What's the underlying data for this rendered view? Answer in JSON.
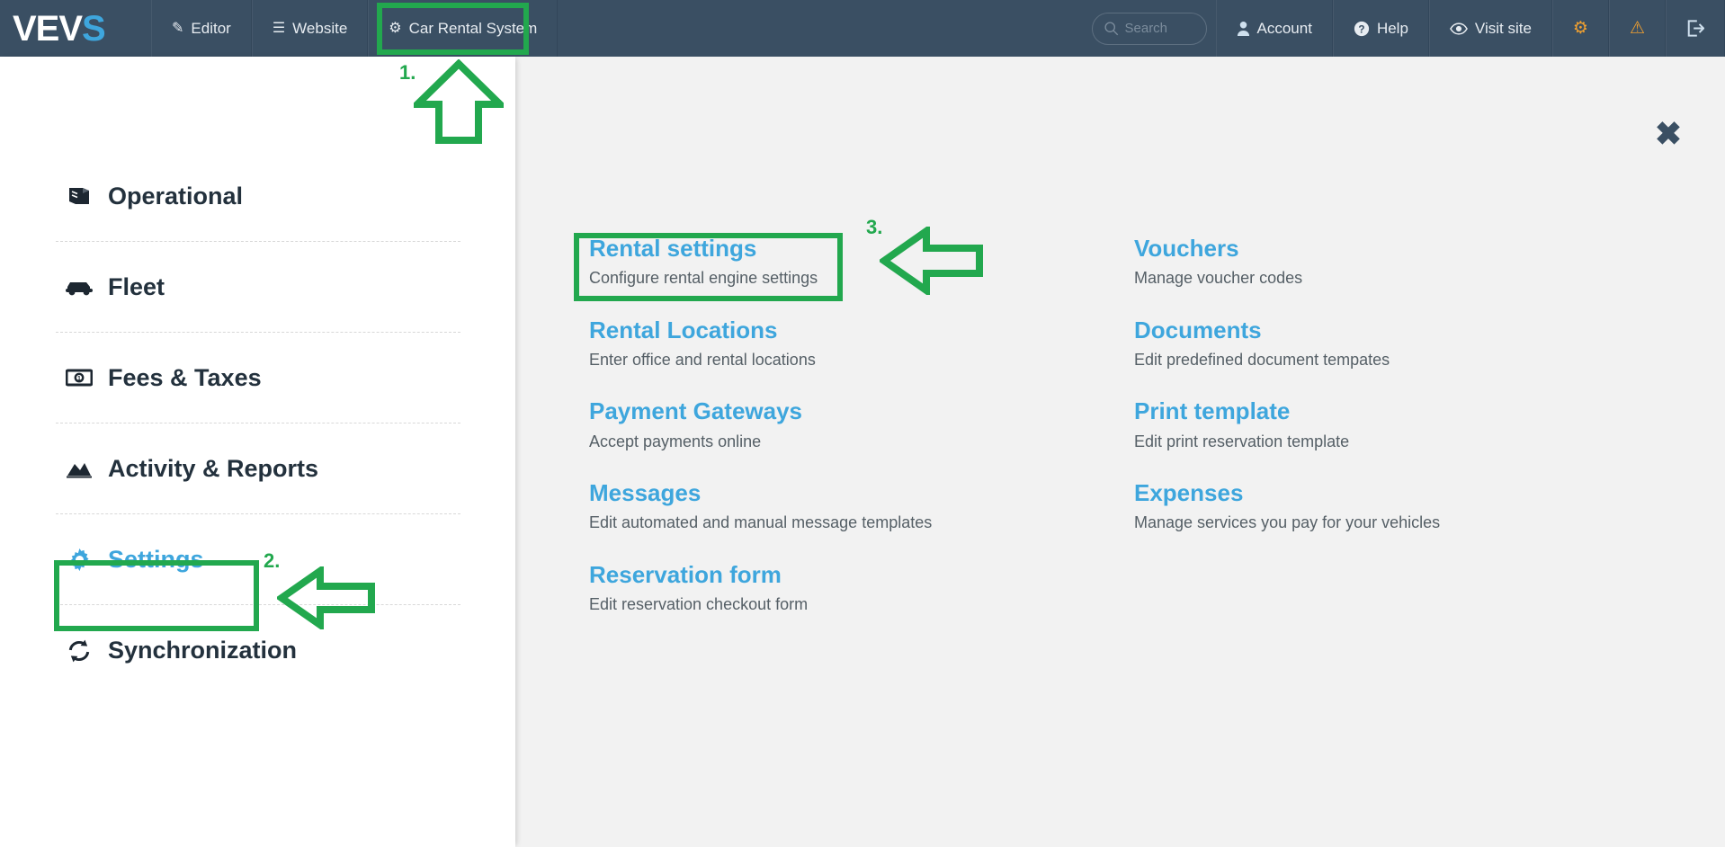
{
  "topbar": {
    "logo": {
      "white": "VEV",
      "accent": "S",
      "accent_color": "#3ea6dd"
    },
    "nav": [
      {
        "label": "Editor",
        "icon": "pencil-icon",
        "glyph": "✎"
      },
      {
        "label": "Website",
        "icon": "list-icon",
        "glyph": "☰"
      },
      {
        "label": "Car Rental System",
        "icon": "gear-icon",
        "glyph": "⚙"
      }
    ],
    "search": {
      "placeholder": "Search",
      "value": "",
      "icon": "search-icon",
      "glyph": "⚲"
    },
    "right": [
      {
        "label": "Account",
        "icon": "user-icon",
        "glyph": "♟"
      },
      {
        "label": "Help",
        "icon": "question-circle-icon",
        "glyph": "❓"
      },
      {
        "label": "Visit site",
        "icon": "eye-icon",
        "glyph": "◉"
      }
    ],
    "icon_buttons": [
      {
        "name": "settings-gear-icon",
        "glyph": "⚙",
        "color": "#f0a030"
      },
      {
        "name": "warning-icon",
        "glyph": "⚠",
        "color": "#f0a030"
      },
      {
        "name": "logout-icon",
        "glyph": "↪",
        "color": "#cfe0ee"
      }
    ],
    "bar_color": "#3a4f63"
  },
  "sidebar": {
    "items": [
      {
        "label": "Operational",
        "icon": "book-icon",
        "active": false
      },
      {
        "label": "Fleet",
        "icon": "car-icon",
        "active": false
      },
      {
        "label": "Fees & Taxes",
        "icon": "money-bill-icon",
        "active": false
      },
      {
        "label": "Activity & Reports",
        "icon": "area-chart-icon",
        "active": false
      },
      {
        "label": "Settings",
        "icon": "gear-icon",
        "active": true
      },
      {
        "label": "Synchronization",
        "icon": "sync-icon",
        "active": false
      }
    ],
    "active_color": "#3ea6dd"
  },
  "main": {
    "close_label": "✖",
    "link_color": "#3ea6dd",
    "background": "#f2f2f2",
    "left_column": [
      {
        "title": "Rental settings",
        "desc": "Configure rental engine settings"
      },
      {
        "title": "Rental Locations",
        "desc": "Enter office and rental locations"
      },
      {
        "title": "Payment Gateways",
        "desc": "Accept payments online"
      },
      {
        "title": "Messages",
        "desc": "Edit automated and manual message templates"
      },
      {
        "title": "Reservation form",
        "desc": "Edit reservation checkout form"
      }
    ],
    "right_column": [
      {
        "title": "Vouchers",
        "desc": "Manage voucher codes"
      },
      {
        "title": "Documents",
        "desc": "Edit predefined document tempates"
      },
      {
        "title": "Print template",
        "desc": "Edit print reservation template"
      },
      {
        "title": "Expenses",
        "desc": "Manage services you pay for your vehicles"
      }
    ]
  },
  "annotations": {
    "color": "#22a84e",
    "markers": [
      {
        "number": "1.",
        "target": "Car Rental System",
        "arrow": "up"
      },
      {
        "number": "2.",
        "target": "Settings",
        "arrow": "left"
      },
      {
        "number": "3.",
        "target": "Rental settings",
        "arrow": "left"
      }
    ]
  }
}
